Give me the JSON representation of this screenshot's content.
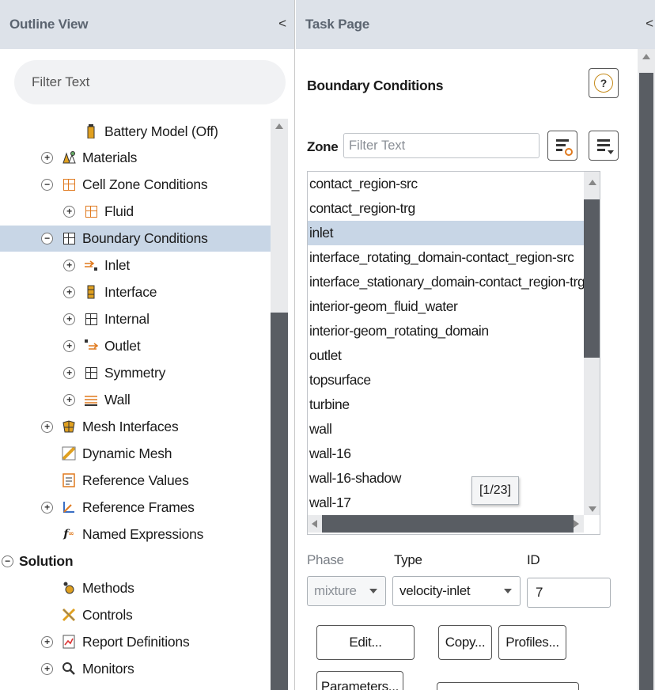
{
  "outline": {
    "title": "Outline View",
    "collapse_glyph": "<",
    "filter_placeholder": "Filter Text",
    "tree": [
      {
        "label": "Battery Model (Off)",
        "icon": "battery-icon",
        "expander": ""
      },
      {
        "label": "Materials",
        "icon": "materials-icon",
        "expander": "+"
      },
      {
        "label": "Cell Zone Conditions",
        "icon": "grid-icon",
        "expander": "−"
      },
      {
        "label": "Fluid",
        "icon": "grid-icon",
        "expander": "+"
      },
      {
        "label": "Boundary Conditions",
        "icon": "grid-icon",
        "expander": "−",
        "selected": true
      },
      {
        "label": "Inlet",
        "icon": "inlet-icon",
        "expander": "+"
      },
      {
        "label": "Interface",
        "icon": "interface-icon",
        "expander": "+"
      },
      {
        "label": "Internal",
        "icon": "grid-icon",
        "expander": "+"
      },
      {
        "label": "Outlet",
        "icon": "outlet-icon",
        "expander": "+"
      },
      {
        "label": "Symmetry",
        "icon": "grid-icon",
        "expander": "+"
      },
      {
        "label": "Wall",
        "icon": "wall-icon",
        "expander": "+"
      },
      {
        "label": "Mesh Interfaces",
        "icon": "mesh-interfaces-icon",
        "expander": "+"
      },
      {
        "label": "Dynamic Mesh",
        "icon": "dynamic-mesh-icon",
        "expander": ""
      },
      {
        "label": "Reference Values",
        "icon": "reference-values-icon",
        "expander": ""
      },
      {
        "label": "Reference Frames",
        "icon": "reference-frames-icon",
        "expander": "+"
      },
      {
        "label": "Named Expressions",
        "icon": "function-icon",
        "expander": ""
      },
      {
        "label": "Solution",
        "icon": "",
        "expander": "−",
        "bold": true
      },
      {
        "label": "Methods",
        "icon": "methods-icon",
        "expander": ""
      },
      {
        "label": "Controls",
        "icon": "controls-icon",
        "expander": ""
      },
      {
        "label": "Report Definitions",
        "icon": "report-definitions-icon",
        "expander": "+"
      },
      {
        "label": "Monitors",
        "icon": "monitors-icon",
        "expander": "+"
      }
    ]
  },
  "task": {
    "title": "Task Page",
    "collapse_glyph": "<",
    "section_title": "Boundary Conditions",
    "help_glyph": "?",
    "zone_label": "Zone",
    "zone_filter_placeholder": "Filter Text",
    "zones": [
      "contact_region-src",
      "contact_region-trg",
      "inlet",
      "interface_rotating_domain-contact_region-src",
      "interface_stationary_domain-contact_region-trg",
      "interior-geom_fluid_water",
      "interior-geom_rotating_domain",
      "outlet",
      "topsurface",
      "turbine",
      "wall",
      "wall-16",
      "wall-16-shadow",
      "wall-17"
    ],
    "selected_zone": "inlet",
    "count_tooltip": "[1/23]",
    "phase_label": "Phase",
    "phase_value": "mixture",
    "type_label": "Type",
    "type_value": "velocity-inlet",
    "id_label": "ID",
    "id_value": "7",
    "buttons": {
      "edit": "Edit...",
      "copy": "Copy...",
      "profiles": "Profiles...",
      "parameters": "Parameters..."
    }
  },
  "colors": {
    "header_bg": "#dde2e9",
    "header_text": "#5b6470",
    "selection": "#c8d6e6",
    "scroll_thumb": "#595d63",
    "accent_orange": "#e07a1f"
  }
}
